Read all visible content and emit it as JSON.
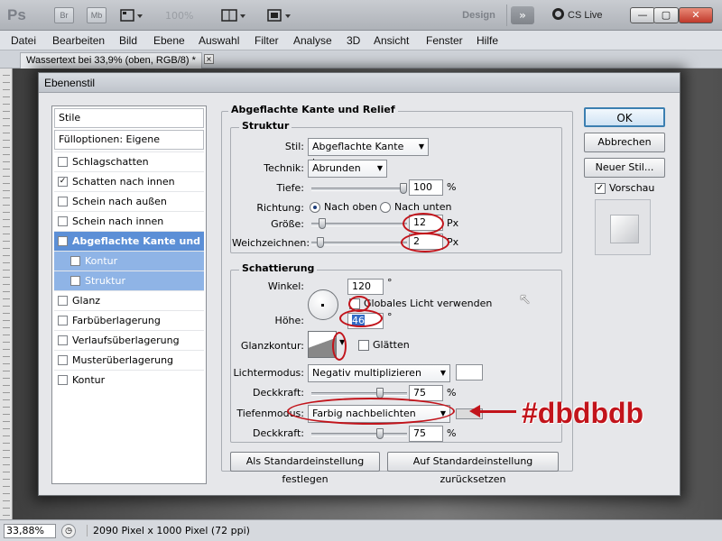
{
  "app": {
    "logo": "Ps",
    "bridge_label": "Br",
    "minibridge_label": "Mb",
    "zoom": "100%",
    "workspace": "Design",
    "cslive": "CS Live",
    "win_min": "—",
    "win_max": "▢",
    "win_close": "✕"
  },
  "menu": [
    "Datei",
    "Bearbeiten",
    "Bild",
    "Ebene",
    "Auswahl",
    "Filter",
    "Analyse",
    "3D",
    "Ansicht",
    "Fenster",
    "Hilfe"
  ],
  "document": {
    "tab": "Wassertext bei 33,9% (oben, RGB/8) *",
    "tab_close": "×"
  },
  "status": {
    "zoom": "33,88%",
    "info": "2090 Pixel x 1000 Pixel (72 ppi)"
  },
  "dialog": {
    "title": "Ebenenstil",
    "styles_header": "Stile",
    "fill_options": "Fülloptionen: Eigene",
    "items": [
      {
        "label": "Schlagschatten",
        "checked": ""
      },
      {
        "label": "Schatten nach innen",
        "checked": "✓"
      },
      {
        "label": "Schein nach außen",
        "checked": ""
      },
      {
        "label": "Schein nach innen",
        "checked": ""
      },
      {
        "label": "Abgeflachte Kante und Relief",
        "checked": "✓"
      },
      {
        "label": "Kontur",
        "checked": ""
      },
      {
        "label": "Struktur",
        "checked": ""
      },
      {
        "label": "Glanz",
        "checked": ""
      },
      {
        "label": "Farbüberlagerung",
        "checked": ""
      },
      {
        "label": "Verlaufsüberlagerung",
        "checked": ""
      },
      {
        "label": "Musterüberlagerung",
        "checked": ""
      },
      {
        "label": "Kontur",
        "checked": ""
      }
    ],
    "section_title": "Abgeflachte Kante und Relief",
    "struktur": {
      "legend": "Struktur",
      "stil_label": "Stil:",
      "stil_value": "Abgeflachte Kante innen",
      "technik_label": "Technik:",
      "technik_value": "Abrunden",
      "tiefe_label": "Tiefe:",
      "tiefe_value": "100",
      "tiefe_unit": "%",
      "tiefe_fraction": 1.0,
      "richtung_label": "Richtung:",
      "richtung_up": "Nach oben",
      "richtung_down": "Nach unten",
      "groesse_label": "Größe:",
      "groesse_value": "12",
      "groesse_unit": "Px",
      "weich_label": "Weichzeichnen:",
      "weich_value": "2",
      "weich_unit": "Px"
    },
    "schattierung": {
      "legend": "Schattierung",
      "winkel_label": "Winkel:",
      "winkel_value": "120",
      "winkel_unit": "°",
      "global_light": "Globales Licht verwenden",
      "hoehe_label": "Höhe:",
      "hoehe_value": "46",
      "hoehe_unit": "°",
      "glanzkontur_label": "Glanzkontur:",
      "glaetten": "Glätten",
      "lichter_label": "Lichtermodus:",
      "lichter_value": "Negativ multiplizieren",
      "lichter_color": "#ffffff",
      "deck1_label": "Deckkraft:",
      "deck1_value": "75",
      "deck1_unit": "%",
      "tiefen_label": "Tiefenmodus:",
      "tiefen_value": "Farbig nachbelichten",
      "tiefen_color": "#dbdbdb",
      "deck2_label": "Deckkraft:",
      "deck2_value": "75",
      "deck2_unit": "%"
    },
    "btn_default_set": "Als Standardeinstellung festlegen",
    "btn_default_reset": "Auf Standardeinstellung zurücksetzen",
    "btn_ok": "OK",
    "btn_cancel": "Abbrechen",
    "btn_new_style": "Neuer Stil...",
    "preview_label": "Vorschau",
    "preview_checked": "✓"
  },
  "annotation": {
    "text": "#dbdbdb",
    "color": "#c2141b"
  }
}
